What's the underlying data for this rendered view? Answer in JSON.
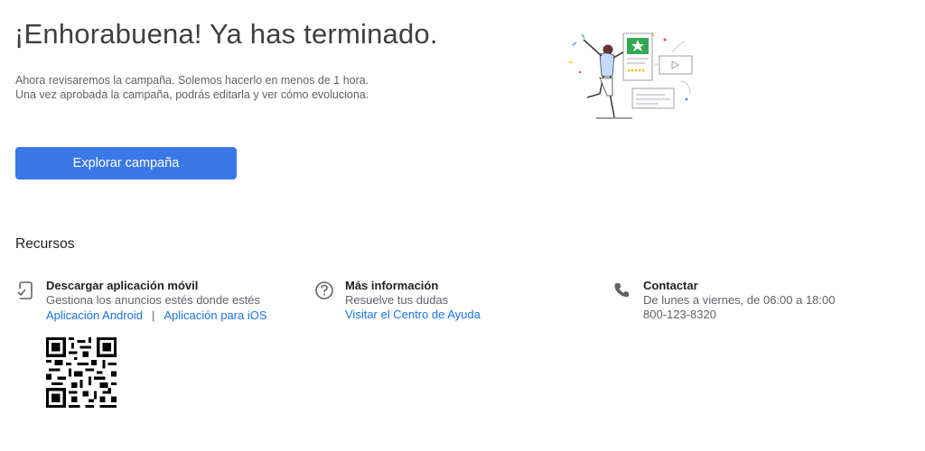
{
  "header": {
    "title": "¡Enhorabuena! Ya has terminado.",
    "line1": "Ahora revisaremos la campaña. Solemos hacerlo en menos de 1 hora.",
    "line2": "Una vez aprobada la campaña, podrás editarla y ver cómo evoluciona."
  },
  "primary_button": {
    "label": "Explorar campaña",
    "color": "#3b78e7"
  },
  "resources": {
    "title": "Recursos",
    "app": {
      "icon": "phone-check-icon",
      "heading": "Descargar aplicación móvil",
      "description": "Gestiona los anuncios estés donde estés",
      "link_android": "Aplicación Android",
      "separator": "|",
      "link_ios": "Aplicación para iOS",
      "qr": "qr-code"
    },
    "info": {
      "icon": "help-circle-icon",
      "heading": "Más información",
      "description": "Resuelve tus dudas",
      "link": "Visitar el Centro de Ayuda"
    },
    "contact": {
      "icon": "phone-icon",
      "heading": "Contactar",
      "hours": "De lunes a viernes, de 06:00 a 18:00",
      "phone": "800-123-8320"
    }
  },
  "colors": {
    "link": "#1a73e8",
    "accent_green": "#34a853"
  }
}
